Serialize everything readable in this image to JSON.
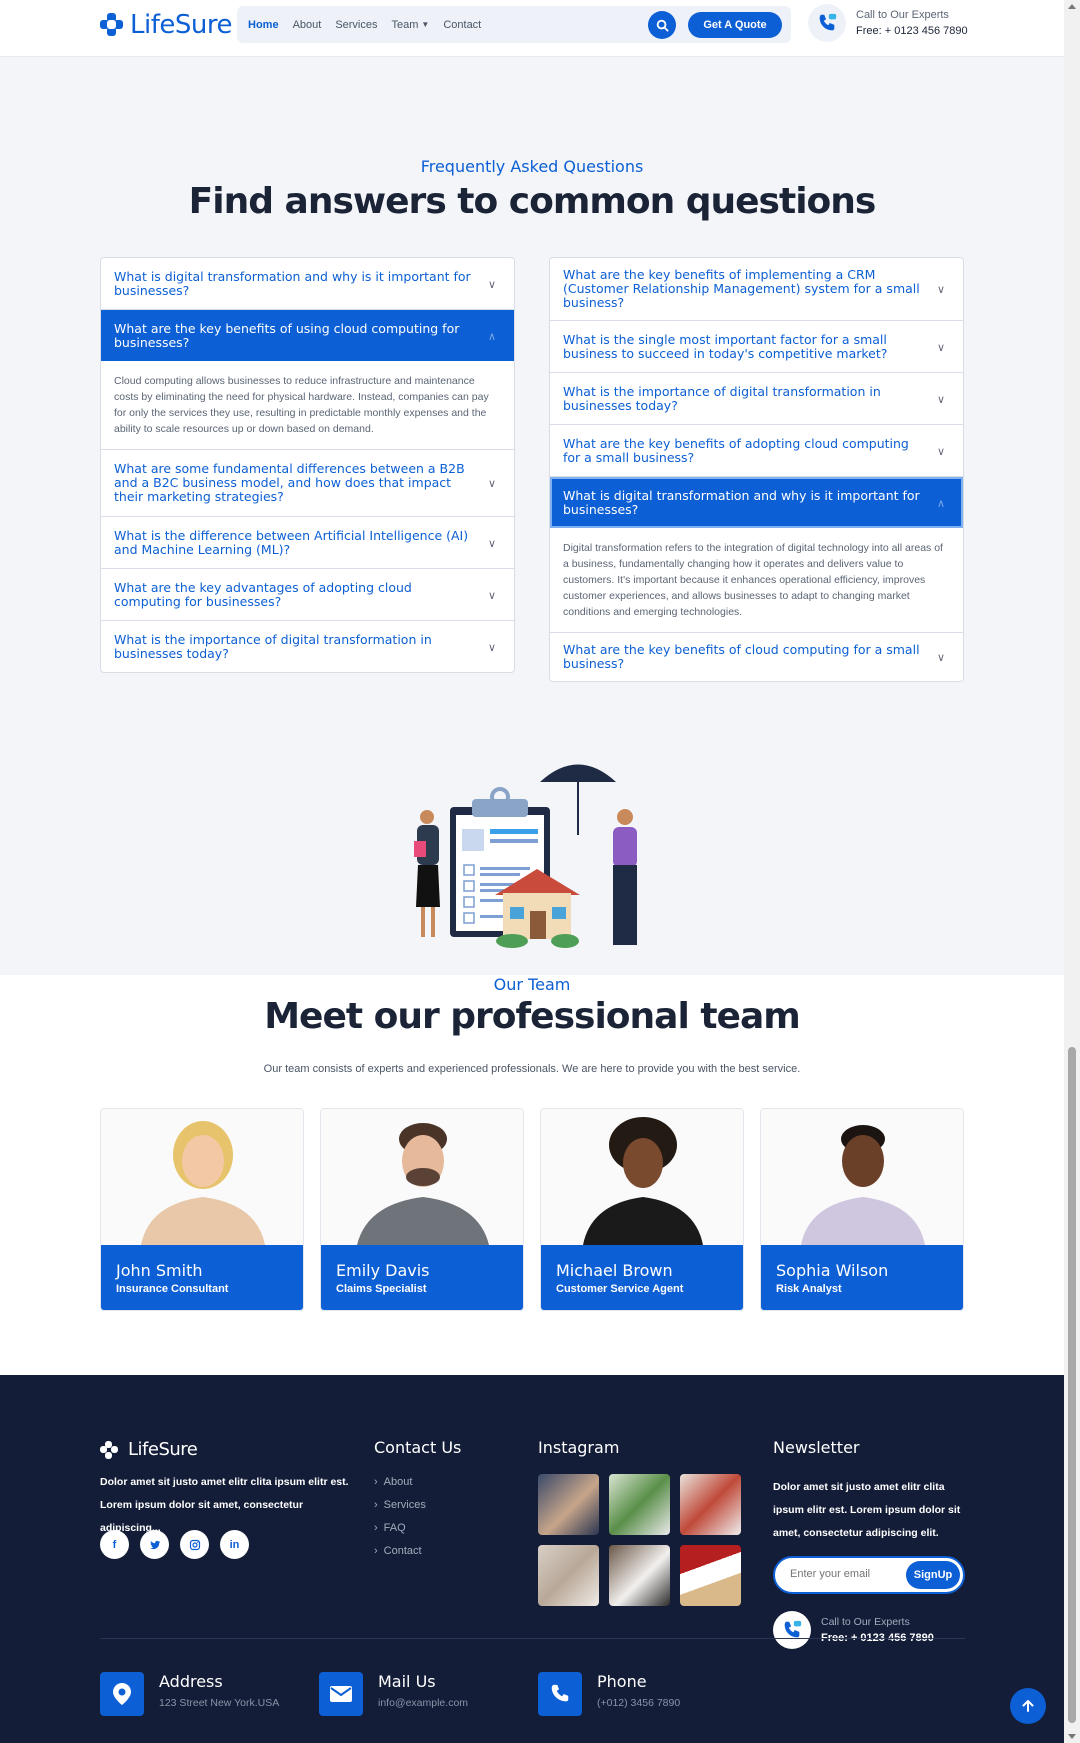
{
  "header": {
    "logo": "LifeSure",
    "nav": [
      "Home",
      "About",
      "Services",
      "Team",
      "Contact"
    ],
    "quote_label": "Get A Quote",
    "call_label": "Call to Our Experts",
    "call_number": "Free: + 0123 456 7890"
  },
  "faq": {
    "subtitle": "Frequently Asked Questions",
    "title": "Find answers to common questions",
    "left": [
      {
        "q": "What is digital transformation and why is it important for businesses?"
      },
      {
        "q": "What are the key benefits of using cloud computing for businesses?",
        "a": "Cloud computing allows businesses to reduce infrastructure and maintenance costs by eliminating the need for physical hardware. Instead, companies can pay for only the services they use, resulting in predictable monthly expenses and the ability to scale resources up or down based on demand."
      },
      {
        "q": "What are some fundamental differences between a B2B and a B2C business model, and how does that impact their marketing strategies?"
      },
      {
        "q": "What is the difference between Artificial Intelligence (AI) and Machine Learning (ML)?"
      },
      {
        "q": "What are the key advantages of adopting cloud computing for businesses?"
      },
      {
        "q": "What is the importance of digital transformation in businesses today?"
      }
    ],
    "right": [
      {
        "q": "What are the key benefits of implementing a CRM (Customer Relationship Management) system for a small business?"
      },
      {
        "q": "What is the single most important factor for a small business to succeed in today's competitive market?"
      },
      {
        "q": "What is the importance of digital transformation in businesses today?"
      },
      {
        "q": "What are the key benefits of adopting cloud computing for a small business?"
      },
      {
        "q": "What is digital transformation and why is it important for businesses?",
        "a": "Digital transformation refers to the integration of digital technology into all areas of a business, fundamentally changing how it operates and delivers value to customers. It's important because it enhances operational efficiency, improves customer experiences, and allows businesses to adapt to changing market conditions and emerging technologies."
      },
      {
        "q": "What are the key benefits of cloud computing for a small business?"
      }
    ]
  },
  "team": {
    "subtitle": "Our Team",
    "title": "Meet our professional team",
    "description": "Our team consists of experts and experienced professionals. We are here to provide you with the best service.",
    "members": [
      {
        "name": "John Smith",
        "role": "Insurance Consultant"
      },
      {
        "name": "Emily Davis",
        "role": "Claims Specialist"
      },
      {
        "name": "Michael Brown",
        "role": "Customer Service Agent"
      },
      {
        "name": "Sophia Wilson",
        "role": "Risk Analyst"
      }
    ]
  },
  "footer": {
    "logo": "LifeSure",
    "about_line1": "Dolor amet sit justo amet elitr clita ipsum elitr est.",
    "about_line2": "Lorem ipsum dolor sit amet, consectetur adipiscing...",
    "socials": [
      "f",
      "t",
      "ig",
      "in"
    ],
    "contact_heading": "Contact Us",
    "links": [
      "About",
      "Services",
      "FAQ",
      "Contact"
    ],
    "instagram_heading": "Instagram",
    "newsletter_heading": "Newsletter",
    "newsletter_text": "Dolor amet sit justo amet elitr clita ipsum elitr est. Lorem ipsum dolor sit amet, consectetur adipiscing elit.",
    "email_placeholder": "Enter your email",
    "signup_label": "SignUp",
    "call_label": "Call to Our Experts",
    "call_number": "Free: + 0123 456 7890",
    "address_title": "Address",
    "address_value": "123 Street New York.USA",
    "mail_title": "Mail Us",
    "mail_value": "info@example.com",
    "phone_title": "Phone",
    "phone_value": "(+012) 3456 7890"
  },
  "colors": {
    "primary": "#0c5fd4",
    "footer_bg": "#141d38",
    "page_bg": "#f3f5f9"
  }
}
